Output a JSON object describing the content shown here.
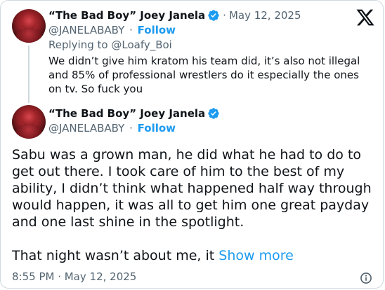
{
  "reply_tweet": {
    "display_name": "“The Bad Boy” Joey Janela",
    "date": "May 12, 2025",
    "handle": "@JANELABABY",
    "follow_label": "Follow",
    "replying_prefix": "Replying to",
    "replying_to": "@Loafy_Boi",
    "text": "We didn’t give him kratom his team did, it’s also not illegal and 85% of professional wrestlers do it especially the ones on tv. So fuck you"
  },
  "main_tweet": {
    "display_name": "“The Bad Boy” Joey Janela",
    "handle": "@JANELABABY",
    "follow_label": "Follow",
    "paragraph1": "Sabu was a grown man, he did what he had to do to get out there. I took care of him to the best of my ability, I didn’t think what happened half way through would happen, it was all to get him one great payday and one last shine in the spotlight.",
    "paragraph2": "That night wasn’t about me, it",
    "show_more_label": "Show more",
    "timestamp": "8:55 PM · May 12, 2025"
  },
  "separator": "·",
  "icons": {
    "brand": "x-logo-icon",
    "verified": "verified-badge-icon",
    "info": "info-icon"
  },
  "colors": {
    "accent": "#1d9bf0",
    "text": "#0f1419",
    "muted": "#536471",
    "border": "#cfd9de"
  }
}
